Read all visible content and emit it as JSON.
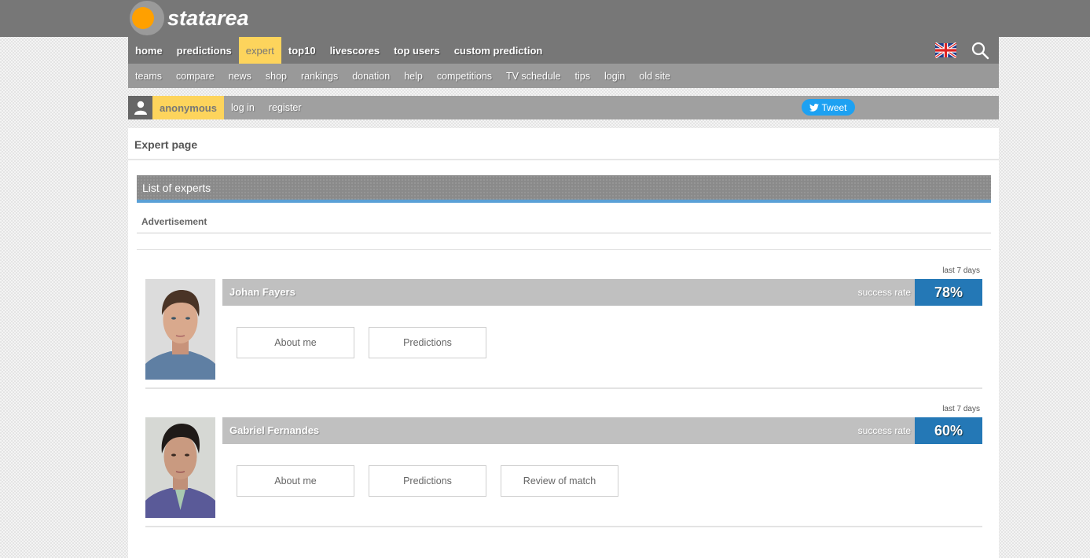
{
  "logo": {
    "text": "statarea"
  },
  "main_nav": {
    "items": [
      {
        "label": "home",
        "active": false
      },
      {
        "label": "predictions",
        "active": false
      },
      {
        "label": "expert",
        "active": true
      },
      {
        "label": "top10",
        "active": false
      },
      {
        "label": "livescores",
        "active": false
      },
      {
        "label": "top users",
        "active": false
      },
      {
        "label": "custom prediction",
        "active": false
      }
    ],
    "language_icon": "uk-flag-icon",
    "search_icon": "search-icon"
  },
  "sub_nav": {
    "items": [
      "teams",
      "compare",
      "news",
      "shop",
      "rankings",
      "donation",
      "help",
      "competitions",
      "TV schedule",
      "tips",
      "login",
      "old site"
    ]
  },
  "user_bar": {
    "user_icon": "user-icon",
    "username": "anonymous",
    "login_label": "log in",
    "register_label": "register",
    "tweet_label": "Tweet"
  },
  "page": {
    "title": "Expert page",
    "section_title": "List of experts",
    "advertisement_label": "Advertisement"
  },
  "experts": [
    {
      "name": "Johan Fayers",
      "period": "last 7 days",
      "success_label": "success rate",
      "success_rate": "78%",
      "buttons": [
        "About me",
        "Predictions"
      ]
    },
    {
      "name": "Gabriel Fernandes",
      "period": "last 7 days",
      "success_label": "success rate",
      "success_rate": "60%",
      "buttons": [
        "About me",
        "Predictions",
        "Review of match"
      ]
    }
  ],
  "colors": {
    "accent_yellow": "#fdd45c",
    "rate_blue": "#2478b6",
    "logo_orange": "#ffa000",
    "tweet_blue": "#1da1f2"
  }
}
